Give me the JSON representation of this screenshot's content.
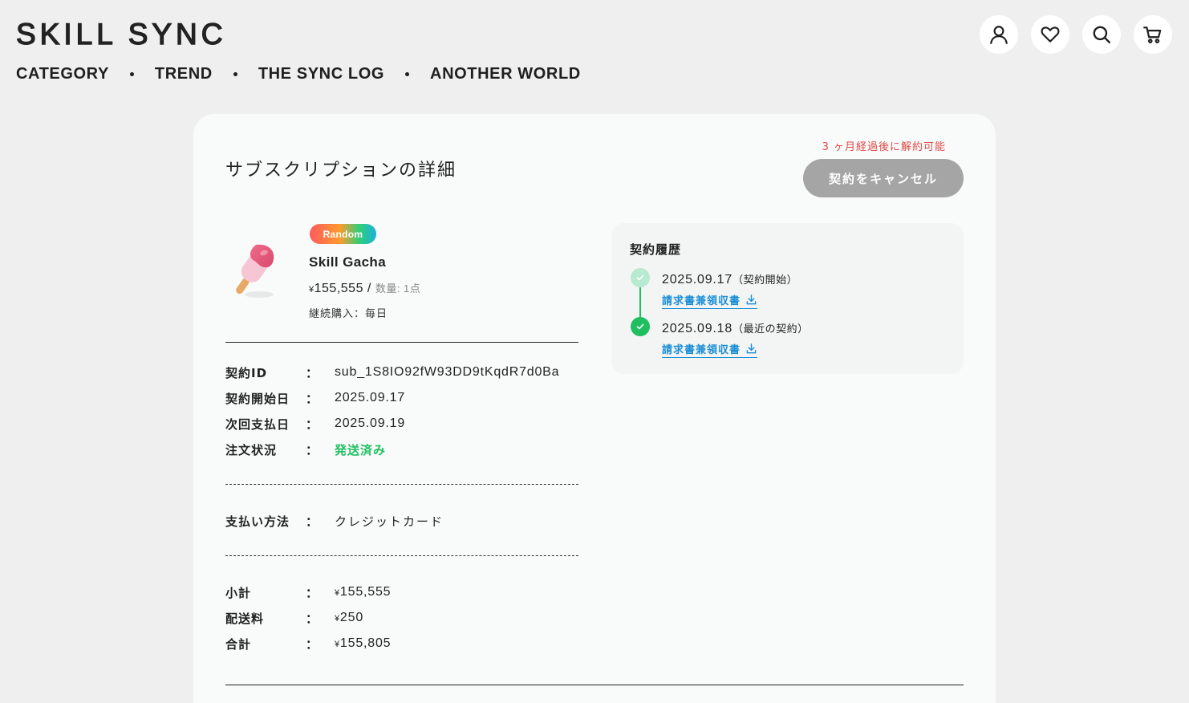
{
  "brand": {
    "logo": "SKILL SYNC"
  },
  "nav": [
    {
      "label": "CATEGORY"
    },
    {
      "label": "TREND"
    },
    {
      "label": "THE SYNC LOG"
    },
    {
      "label": "ANOTHER WORLD"
    }
  ],
  "header_icons": [
    "user-icon",
    "heart-icon",
    "search-icon",
    "cart-icon"
  ],
  "page": {
    "title": "サブスクリプションの詳細",
    "cancel_note": "3 ヶ月経過後に解約可能",
    "cancel_button": "契約をキャンセル"
  },
  "product": {
    "badge": "Random",
    "name": "Skill Gacha",
    "currency": "¥",
    "price": "155,555",
    "separator": " / ",
    "quantity": "数量: 1点",
    "continuous": "継続購入：毎日"
  },
  "details": [
    {
      "label": "契約ID",
      "value": "sub_1S8IO92fW93DD9tKqdR7d0Ba"
    },
    {
      "label": "契約開始日",
      "value": "2025.09.17"
    },
    {
      "label": "次回支払日",
      "value": "2025.09.19"
    },
    {
      "label": "注文状況",
      "value": "発送済み"
    }
  ],
  "payment": {
    "label": "支払い方法",
    "value": "クレジットカード"
  },
  "totals": [
    {
      "label": "小計",
      "value": "155,555"
    },
    {
      "label": "配送料",
      "value": "250"
    },
    {
      "label": "合計",
      "value": "155,805"
    }
  ],
  "colon": "：",
  "history": {
    "title": "契約履歴",
    "entries": [
      {
        "date": "2025.09.17",
        "note": "（契約開始）",
        "link": "請求書兼領収書"
      },
      {
        "date": "2025.09.18",
        "note": "（最近の契約）",
        "link": "請求書兼領収書"
      }
    ]
  },
  "colors": {
    "accent_green": "#1fbf60",
    "warning_red": "#e04848",
    "link_blue": "#1a8fd6",
    "cancel_gray": "#a5a5a5"
  }
}
